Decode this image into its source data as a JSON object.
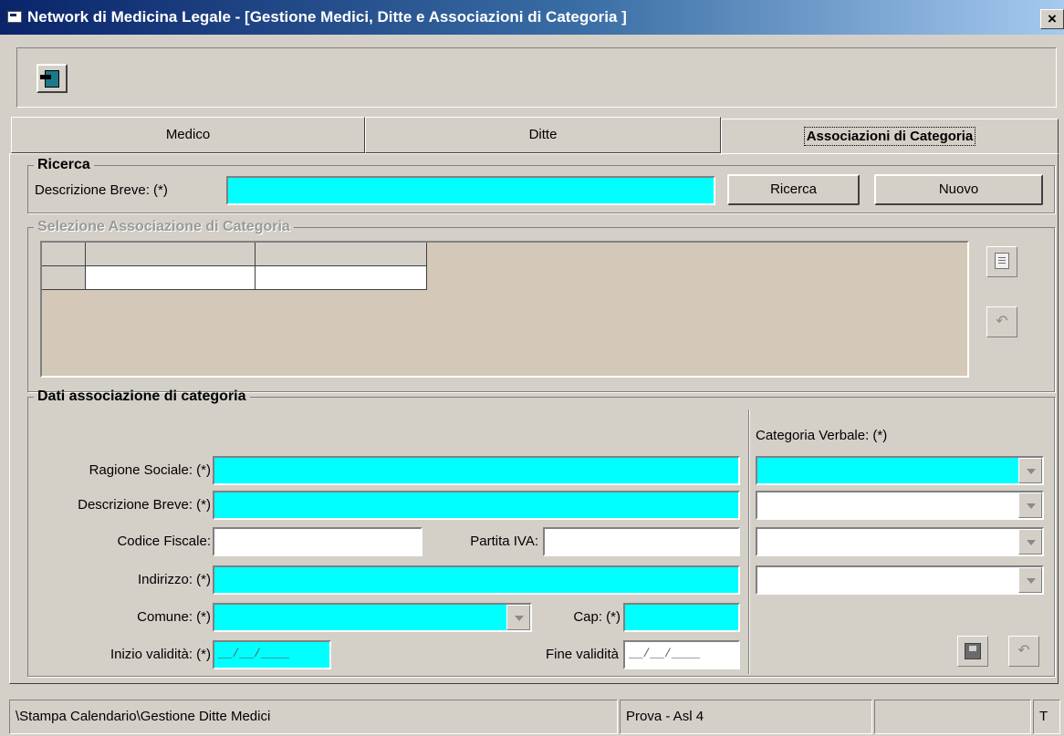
{
  "window": {
    "title": "Network di Medicina Legale - [Gestione Medici, Ditte e Associazioni di Categoria ]",
    "close_glyph": "×"
  },
  "toolbar": {
    "exit_icon": "exit-door-icon"
  },
  "tabs": [
    {
      "label": "Medico",
      "active": false
    },
    {
      "label": "Ditte",
      "active": false
    },
    {
      "label": "Associazioni di Categoria",
      "active": true
    }
  ],
  "search": {
    "legend": "Ricerca",
    "field_label": "Descrizione Breve: (*)",
    "field_value": "",
    "search_button": "Ricerca",
    "new_button": "Nuovo"
  },
  "selection": {
    "legend": "Selezione Associazione di Categoria",
    "edit_icon": "edit-icon",
    "undo_icon": "undo-icon"
  },
  "details": {
    "legend": "Dati associazione di categoria",
    "ragione_sociale_label": "Ragione Sociale: (*)",
    "descrizione_label": "Descrizione Breve: (*)",
    "codice_fiscale_label": "Codice Fiscale:",
    "partita_iva_label": "Partita IVA:",
    "indirizzo_label": "Indirizzo: (*)",
    "comune_label": "Comune: (*)",
    "cap_label": "Cap: (*)",
    "inizio_label": "Inizio validità: (*)",
    "inizio_value": "__/__/____",
    "fine_label": "Fine validità",
    "fine_value": "__/__/____",
    "categoria_label": "Categoria Verbale: (*)",
    "save_icon": "save-icon",
    "undo_icon": "undo-icon"
  },
  "statusbar": {
    "path": "\\Stampa Calendario\\Gestione Ditte Medici",
    "user": "Prova - Asl 4",
    "empty": "",
    "last": "T"
  },
  "colors": {
    "required_field": "#00ffff",
    "face": "#d4d0c8",
    "title_start": "#0a246a"
  }
}
